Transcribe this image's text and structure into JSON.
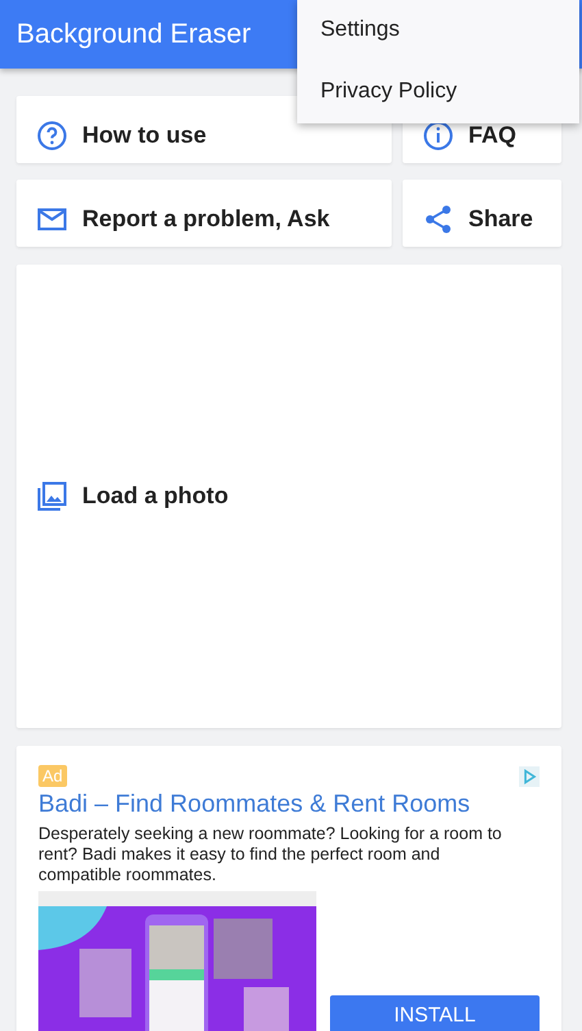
{
  "app_bar": {
    "title": "Background Eraser"
  },
  "menu": {
    "items": [
      {
        "label": "Settings"
      },
      {
        "label": "Privacy Policy"
      }
    ]
  },
  "actions": [
    {
      "label": "How to use"
    },
    {
      "label": "FAQ"
    },
    {
      "label": "Report a problem, Ask"
    },
    {
      "label": "Share"
    }
  ],
  "load": {
    "label": "Load a photo"
  },
  "ad": {
    "badge": "Ad",
    "title": "Badi – Find Roommates & Rent Rooms",
    "description": "Desperately seeking a new roommate? Looking for a room to rent? Badi makes it easy to find the perfect room and compatible roommates.",
    "button": "INSTALL"
  }
}
